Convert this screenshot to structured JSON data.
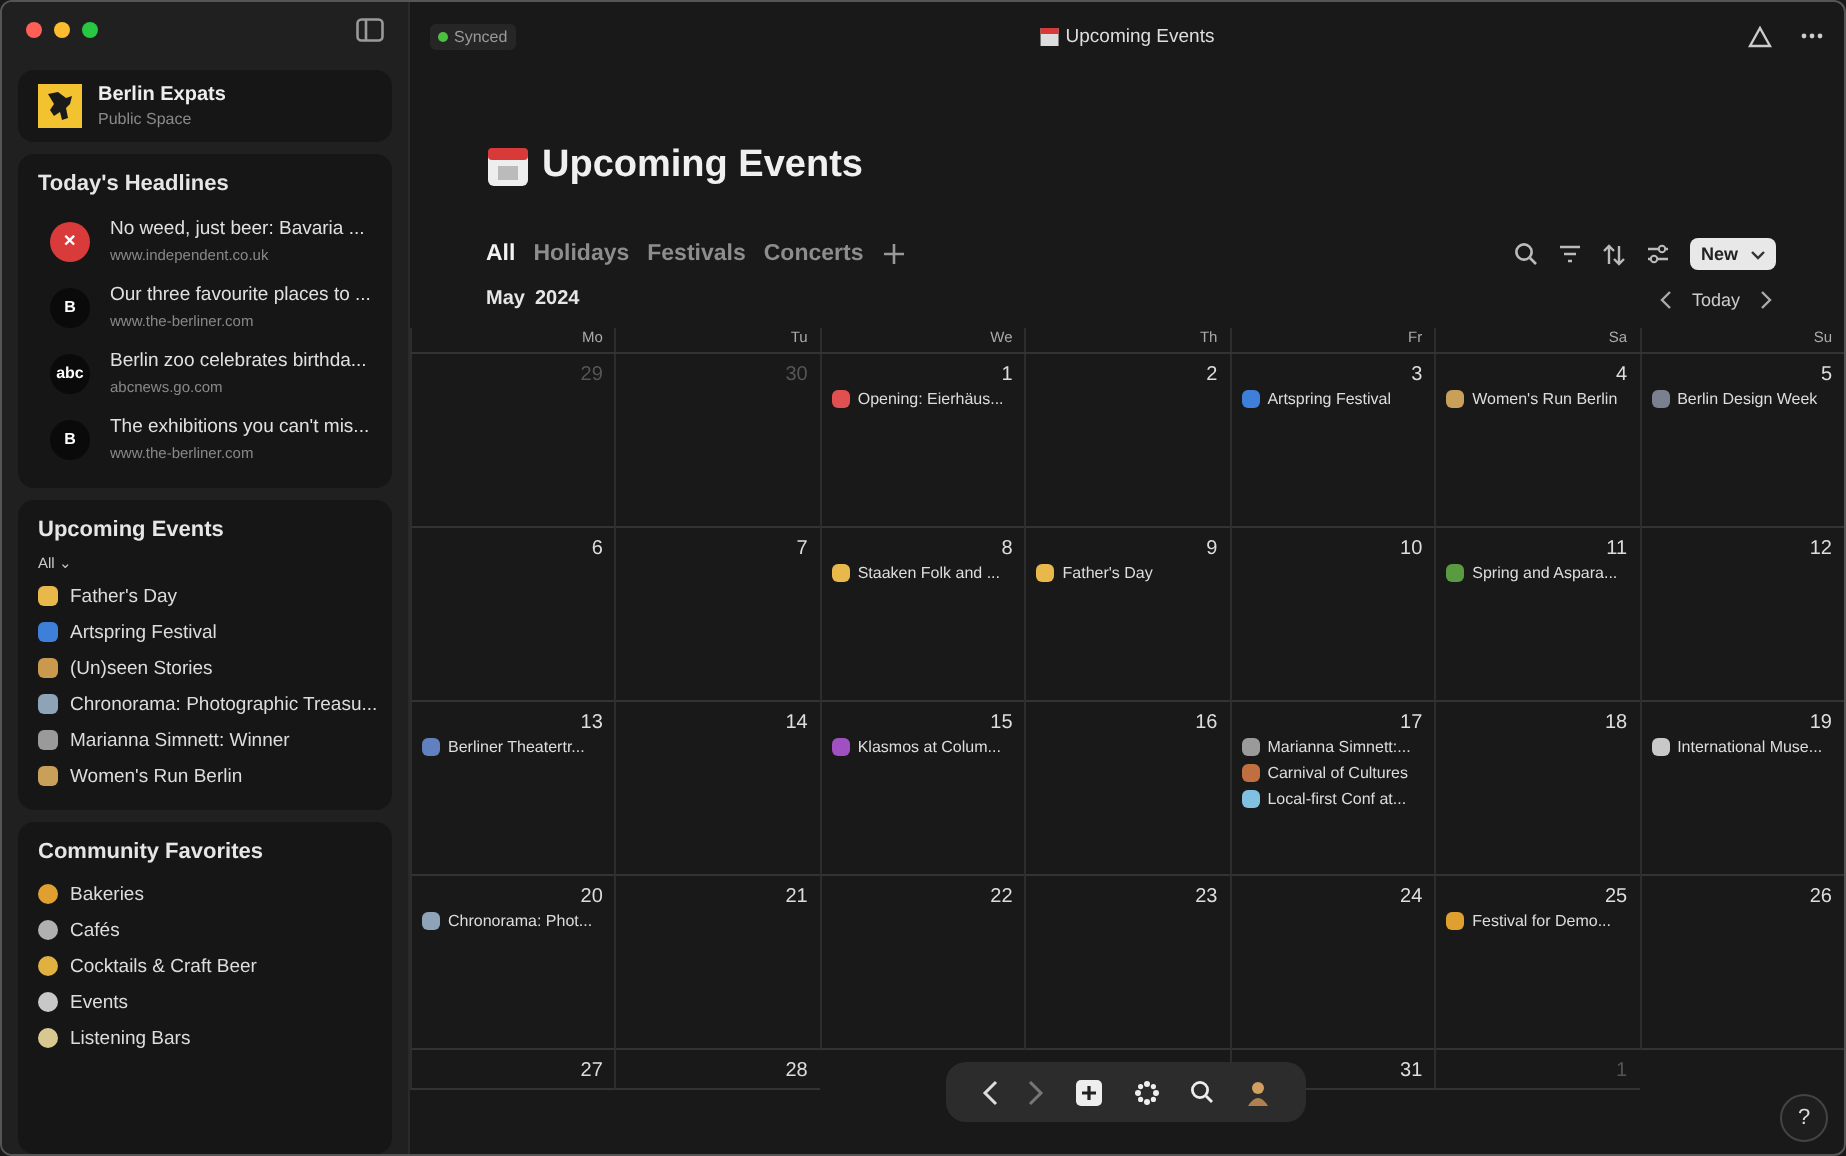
{
  "sidebar": {
    "space": {
      "name": "Berlin Expats",
      "subtitle": "Public Space"
    },
    "headlines": {
      "title": "Today's Headlines",
      "items": [
        {
          "title": "No weed, just beer: Bavaria ...",
          "source": "www.independent.co.uk",
          "color": "#d93a3a",
          "badge": "✕"
        },
        {
          "title": "Our three favourite places to ...",
          "source": "www.the-berliner.com",
          "color": "#0a0a0a",
          "badge": "B"
        },
        {
          "title": "Berlin zoo celebrates birthda...",
          "source": "abcnews.go.com",
          "color": "#0a0a0a",
          "badge": "abc"
        },
        {
          "title": "The exhibitions you can't mis...",
          "source": "www.the-berliner.com",
          "color": "#0a0a0a",
          "badge": "B"
        }
      ]
    },
    "upcoming": {
      "title": "Upcoming Events",
      "filter": "All ⌄",
      "items": [
        {
          "label": "Father's Day",
          "color": "#e8b94a"
        },
        {
          "label": "Artspring Festival",
          "color": "#3d7fd9"
        },
        {
          "label": "(Un)seen Stories",
          "color": "#c99a4e"
        },
        {
          "label": "Chronorama: Photographic Treasu...",
          "color": "#8fa3b8"
        },
        {
          "label": "Marianna Simnett: Winner",
          "color": "#9a9a9a"
        },
        {
          "label": "Women's Run Berlin",
          "color": "#c9a05a"
        }
      ]
    },
    "favorites": {
      "title": "Community Favorites",
      "items": [
        {
          "label": "Bakeries",
          "color": "#e0a030"
        },
        {
          "label": "Cafés",
          "color": "#b0b0b0"
        },
        {
          "label": "Cocktails & Craft Beer",
          "color": "#e0b040"
        },
        {
          "label": "Events",
          "color": "#c8c8c8"
        },
        {
          "label": "Listening Bars",
          "color": "#d8c890"
        }
      ]
    }
  },
  "topbar": {
    "status": "Synced",
    "title": "Upcoming Events"
  },
  "page": {
    "title": "Upcoming Events"
  },
  "tabs": [
    {
      "label": "All",
      "selected": true
    },
    {
      "label": "Holidays",
      "selected": false
    },
    {
      "label": "Festivals",
      "selected": false
    },
    {
      "label": "Concerts",
      "selected": false
    }
  ],
  "toolbar": {
    "new_button": "New"
  },
  "month": {
    "month": "May",
    "year": "2024",
    "today": "Today"
  },
  "weekdays": [
    "Mo",
    "Tu",
    "We",
    "Th",
    "Fr",
    "Sa",
    "Su"
  ],
  "weeks": [
    {
      "days": [
        {
          "day": "29",
          "outside": true
        },
        {
          "day": "30",
          "outside": true
        },
        {
          "day": "1",
          "outside": false,
          "events": [
            {
              "label": "Opening: Eierhäus...",
              "color": "#e05050"
            }
          ]
        },
        {
          "day": "2",
          "outside": false
        },
        {
          "day": "3",
          "outside": false,
          "events": [
            {
              "label": "Artspring Festival",
              "color": "#3d7fd9"
            }
          ]
        },
        {
          "day": "4",
          "outside": false,
          "events": [
            {
              "label": "Women's Run Berlin",
              "color": "#c9a05a"
            }
          ]
        },
        {
          "day": "5",
          "outside": false,
          "events": [
            {
              "label": "Berlin Design Week",
              "color": "#7a8090"
            }
          ]
        }
      ]
    },
    {
      "days": [
        {
          "day": "6",
          "outside": false
        },
        {
          "day": "7",
          "outside": false
        },
        {
          "day": "8",
          "outside": false,
          "events": [
            {
              "label": "Staaken Folk and ...",
              "color": "#e8b94a"
            }
          ]
        },
        {
          "day": "9",
          "outside": false,
          "events": [
            {
              "label": "Father's Day",
              "color": "#e8b94a"
            }
          ]
        },
        {
          "day": "10",
          "outside": false
        },
        {
          "day": "11",
          "outside": false,
          "events": [
            {
              "label": "Spring and Aspara...",
              "color": "#5a9a40"
            }
          ]
        },
        {
          "day": "12",
          "outside": false
        }
      ]
    },
    {
      "days": [
        {
          "day": "13",
          "outside": false,
          "events": [
            {
              "label": "Berliner Theatertr...",
              "color": "#6080c0"
            }
          ]
        },
        {
          "day": "14",
          "outside": false
        },
        {
          "day": "15",
          "outside": false,
          "events": [
            {
              "label": "Klasmos at Colum...",
              "color": "#a050c0"
            }
          ]
        },
        {
          "day": "16",
          "outside": false
        },
        {
          "day": "17",
          "outside": false,
          "events": [
            {
              "label": "Marianna Simnett:...",
              "color": "#9a9a9a"
            },
            {
              "label": "Carnival of Cultures",
              "color": "#c07040"
            },
            {
              "label": "Local-first Conf at...",
              "color": "#80c0e0"
            }
          ]
        },
        {
          "day": "18",
          "outside": false
        },
        {
          "day": "19",
          "outside": false,
          "events": [
            {
              "label": "International Muse...",
              "color": "#c8c8c8"
            }
          ]
        }
      ]
    },
    {
      "days": [
        {
          "day": "20",
          "outside": false,
          "events": [
            {
              "label": "Chronorama: Phot...",
              "color": "#8fa3b8"
            }
          ]
        },
        {
          "day": "21",
          "outside": false
        },
        {
          "day": "22",
          "outside": false
        },
        {
          "day": "23",
          "outside": false
        },
        {
          "day": "24",
          "outside": false
        },
        {
          "day": "25",
          "outside": false,
          "events": [
            {
              "label": "Festival for Demo...",
              "color": "#e0a030"
            }
          ]
        },
        {
          "day": "26",
          "outside": false
        }
      ]
    },
    {
      "days": [
        {
          "day": "27",
          "outside": false
        },
        {
          "day": "28",
          "outside": false
        },
        {
          "covered": true
        },
        {
          "covered": true
        },
        {
          "day": "31",
          "outside": false
        },
        {
          "day": "1",
          "outside": true
        },
        {
          "covered": true
        }
      ]
    }
  ],
  "help": "?"
}
